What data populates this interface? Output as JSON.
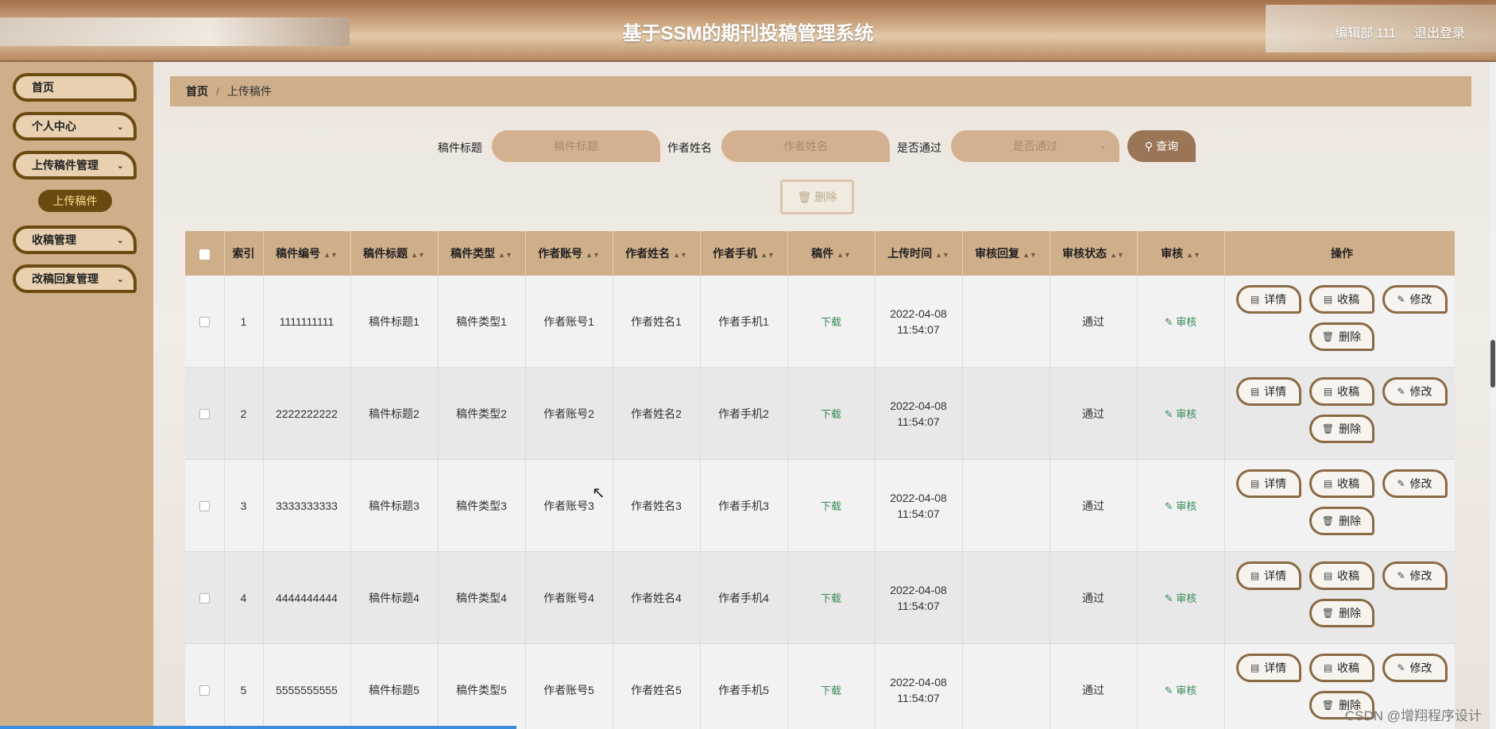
{
  "header": {
    "title": "基于SSM的期刊投稿管理系统",
    "user": "编辑部 111",
    "logout": "退出登录"
  },
  "sidebar": {
    "items": [
      {
        "label": "首页"
      },
      {
        "label": "个人中心"
      },
      {
        "label": "上传稿件管理"
      },
      {
        "label": "收稿管理"
      },
      {
        "label": "改稿回复管理"
      }
    ],
    "submenu": "上传稿件"
  },
  "breadcrumb": {
    "home": "首页",
    "separator": "/",
    "current": "上传稿件"
  },
  "search": {
    "title_label": "稿件标题",
    "title_placeholder": "稿件标题",
    "author_label": "作者姓名",
    "author_placeholder": "作者姓名",
    "pass_label": "是否通过",
    "pass_placeholder": "是否通过",
    "query_button": "查询"
  },
  "delete_button": "删除",
  "table": {
    "headers": [
      "索引",
      "稿件编号",
      "稿件标题",
      "稿件类型",
      "作者账号",
      "作者姓名",
      "作者手机",
      "稿件",
      "上传时间",
      "审核回复",
      "审核状态",
      "审核",
      "操作"
    ],
    "rows": [
      {
        "index": "1",
        "code": "1111111111",
        "title": "稿件标题1",
        "type": "稿件类型1",
        "account": "作者账号1",
        "name": "作者姓名1",
        "phone": "作者手机1",
        "file": "下载",
        "date": "2022-04-08",
        "time": "11:54:07",
        "reply": "",
        "status": "通过",
        "audit": "审核"
      },
      {
        "index": "2",
        "code": "2222222222",
        "title": "稿件标题2",
        "type": "稿件类型2",
        "account": "作者账号2",
        "name": "作者姓名2",
        "phone": "作者手机2",
        "file": "下载",
        "date": "2022-04-08",
        "time": "11:54:07",
        "reply": "",
        "status": "通过",
        "audit": "审核"
      },
      {
        "index": "3",
        "code": "3333333333",
        "title": "稿件标题3",
        "type": "稿件类型3",
        "account": "作者账号3",
        "name": "作者姓名3",
        "phone": "作者手机3",
        "file": "下载",
        "date": "2022-04-08",
        "time": "11:54:07",
        "reply": "",
        "status": "通过",
        "audit": "审核"
      },
      {
        "index": "4",
        "code": "4444444444",
        "title": "稿件标题4",
        "type": "稿件类型4",
        "account": "作者账号4",
        "name": "作者姓名4",
        "phone": "作者手机4",
        "file": "下载",
        "date": "2022-04-08",
        "time": "11:54:07",
        "reply": "",
        "status": "通过",
        "audit": "审核"
      },
      {
        "index": "5",
        "code": "5555555555",
        "title": "稿件标题5",
        "type": "稿件类型5",
        "account": "作者账号5",
        "name": "作者姓名5",
        "phone": "作者手机5",
        "file": "下载",
        "date": "2022-04-08",
        "time": "11:54:07",
        "reply": "",
        "status": "通过",
        "audit": "审核"
      }
    ],
    "ops": {
      "detail": "详情",
      "receive": "收稿",
      "edit": "修改",
      "delete": "删除"
    }
  },
  "watermark": "CSDN @增翔程序设计",
  "colors": {
    "sidebar_bg": "#cfae8a",
    "menu_border": "#6b4a12",
    "submenu_text": "#f6e08a",
    "link_green": "#3a8a55",
    "op_border": "#8a6a44"
  },
  "icons": {
    "search": "search-icon",
    "trash": "trash-icon",
    "doc": "document-icon",
    "pen": "pen-icon",
    "chevron": "chevron-down-icon"
  }
}
